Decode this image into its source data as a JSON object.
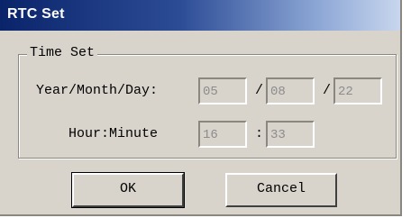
{
  "window": {
    "title": "RTC Set"
  },
  "time_set": {
    "group_label": "Time Set",
    "date_label": "Year/Month/Day:",
    "year": "05",
    "month": "08",
    "day": "22",
    "date_separator": "/",
    "time_label": "Hour:Minute",
    "hour": "16",
    "minute": "33",
    "time_separator": ":"
  },
  "buttons": {
    "ok_label": "OK",
    "cancel_label": "Cancel"
  },
  "colors": {
    "title_bar_start": "#0a246a",
    "title_bar_end": "#c8d6ee",
    "dialog_background": "#d8d4cc",
    "disabled_text": "#8c8c8c"
  }
}
